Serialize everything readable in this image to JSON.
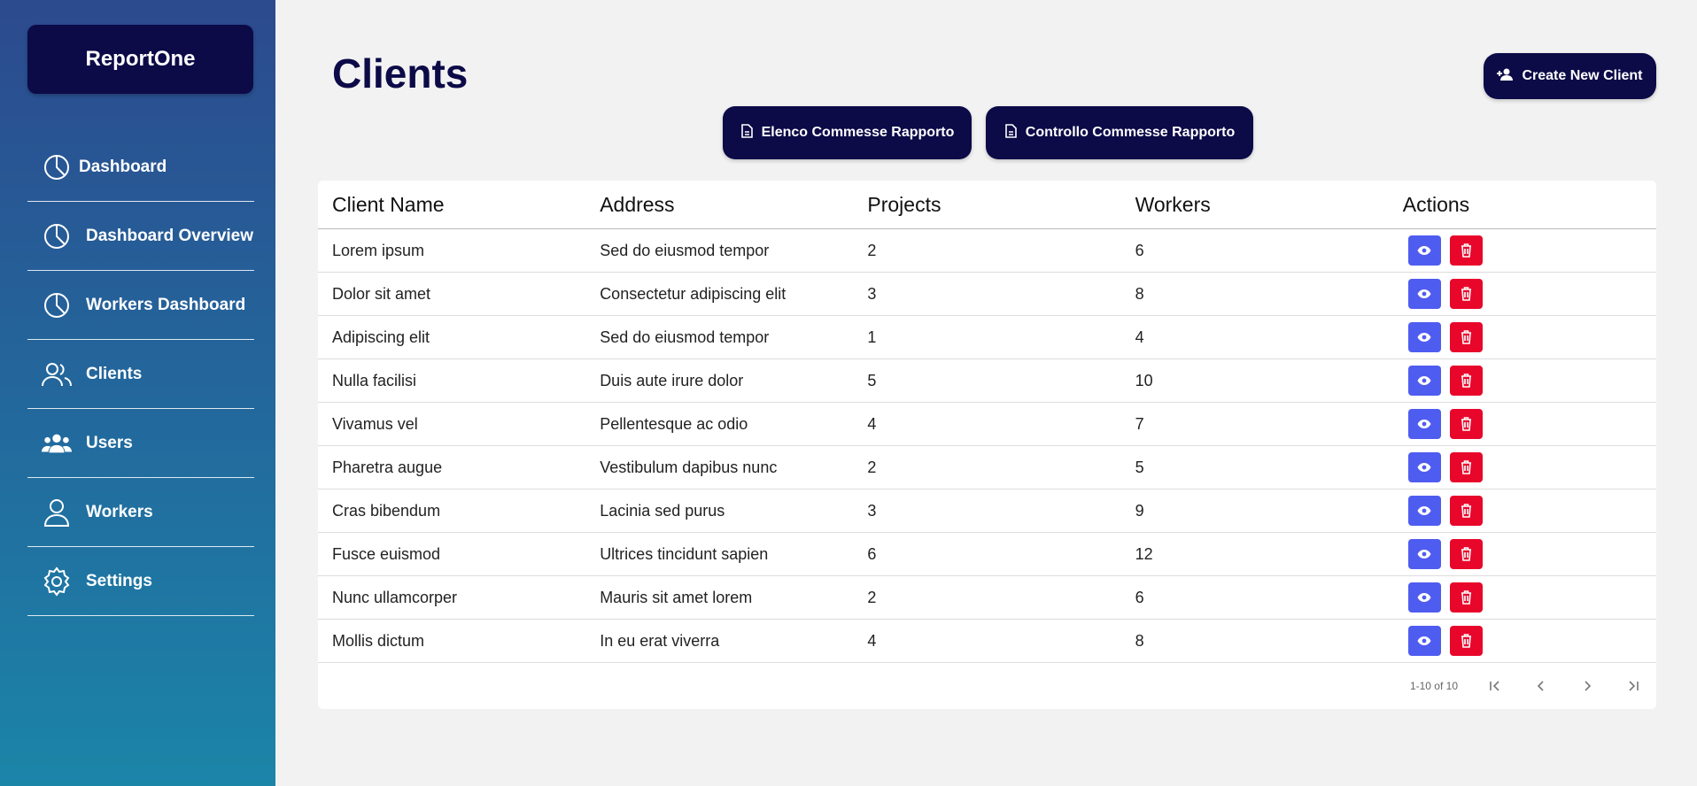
{
  "app": {
    "brand": "ReportOne"
  },
  "sidebar": {
    "items": [
      {
        "label": "Dashboard",
        "icon": "pie-chart-icon"
      },
      {
        "label": "Dashboard Overview",
        "icon": "pie-chart-icon"
      },
      {
        "label": "Workers Dashboard",
        "icon": "pie-chart-icon"
      },
      {
        "label": "Clients",
        "icon": "users-icon"
      },
      {
        "label": "Users",
        "icon": "group-icon"
      },
      {
        "label": "Workers",
        "icon": "user-icon"
      },
      {
        "label": "Settings",
        "icon": "gear-icon"
      }
    ]
  },
  "header": {
    "title": "Clients",
    "create_label": "Create New Client",
    "elenco_label": "Elenco Commesse Rapporto",
    "controllo_label": "Controllo Commesse Rapporto"
  },
  "table": {
    "columns": [
      "Client Name",
      "Address",
      "Projects",
      "Workers",
      "Actions"
    ],
    "rows": [
      [
        "Lorem ipsum",
        "Sed do eiusmod tempor",
        "2",
        "6"
      ],
      [
        "Dolor sit amet",
        "Consectetur adipiscing elit",
        "3",
        "8"
      ],
      [
        "Adipiscing elit",
        "Sed do eiusmod tempor",
        "1",
        "4"
      ],
      [
        "Nulla facilisi",
        "Duis aute irure dolor",
        "5",
        "10"
      ],
      [
        "Vivamus vel",
        "Pellentesque ac odio",
        "4",
        "7"
      ],
      [
        "Pharetra augue",
        "Vestibulum dapibus nunc",
        "2",
        "5"
      ],
      [
        "Cras bibendum",
        "Lacinia sed purus",
        "3",
        "9"
      ],
      [
        "Fusce euismod",
        "Ultrices tincidunt sapien",
        "6",
        "12"
      ],
      [
        "Nunc ullamcorper",
        "Mauris sit amet lorem",
        "2",
        "6"
      ],
      [
        "Mollis dictum",
        "In eu erat viverra",
        "4",
        "8"
      ]
    ]
  },
  "pagination": {
    "range": "1-10 of 10"
  },
  "colors": {
    "primary": "#0c0a47",
    "view": "#4f5cf0",
    "delete": "#e8062b"
  }
}
